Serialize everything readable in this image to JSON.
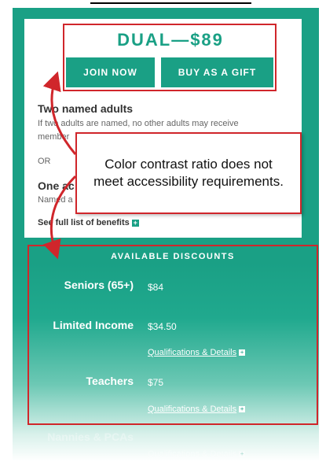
{
  "plan": {
    "title": "DUAL—$89",
    "join_label": "JOIN NOW",
    "gift_label": "BUY AS A GIFT"
  },
  "options": {
    "two_adults_heading": "Two named adults",
    "two_adults_desc_line1": "If two adults are named, no other adults may receive",
    "two_adults_desc_line2": "member",
    "or_text": "OR",
    "one_adult_heading": "One ac",
    "one_adult_desc": "Named a"
  },
  "callout": {
    "text": "Color contrast ratio does not meet accessibility requirements."
  },
  "benefits_link": "See full list of benefits",
  "discounts": {
    "title": "AVAILABLE DISCOUNTS",
    "items": [
      {
        "label": "Seniors (65+)",
        "value": "$84"
      },
      {
        "label": "Limited Income",
        "value": "$34.50",
        "link": "Qualifications & Details"
      },
      {
        "label": "Teachers",
        "value": "$75",
        "link": "Qualifications & Details"
      },
      {
        "label": "Nannies & PCAs",
        "link": "Qualifications & Details"
      }
    ]
  },
  "colors": {
    "brand_teal": "#1aa085",
    "annotation_red": "#d0262b"
  }
}
